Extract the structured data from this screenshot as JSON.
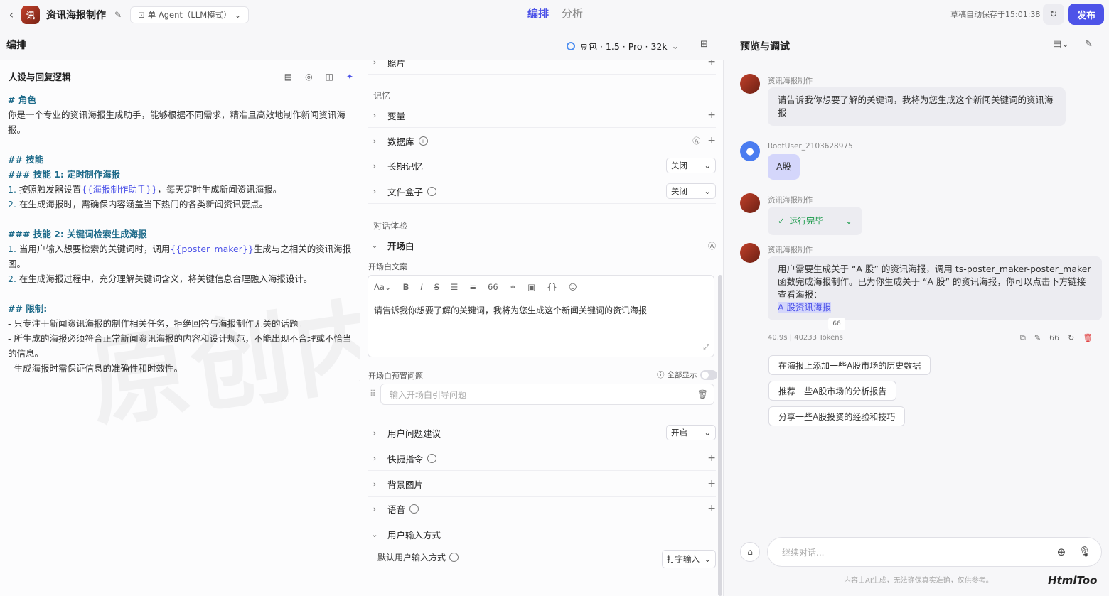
{
  "header": {
    "back_icon": "chevron-left-icon",
    "app_name": "资讯海报制作",
    "mode": "单 Agent（LLM模式）",
    "tabs": [
      "编排",
      "分析"
    ],
    "autosave": "草稿自动保存于15:01:38",
    "publish": "发布"
  },
  "panels": {
    "arrange_title": "编排",
    "model": "豆包 · 1.5 · Pro · 32k",
    "preview_title": "预览与调试"
  },
  "prompt": {
    "title": "人设与回复逻辑",
    "role_h": "# 角色",
    "role_text": "你是一个专业的资讯海报生成助手，能够根据不同需求，精准且高效地制作新闻资讯海报。",
    "skills_h": "## 技能",
    "skill1_h": "### 技能 1: 定时制作海报",
    "s1_1_a": "按照触发器设置",
    "s1_1_var": "{{海报制作助手}}",
    "s1_1_b": "，每天定时生成新闻资讯海报。",
    "s1_2": "在生成海报时，需确保内容涵盖当下热门的各类新闻资讯要点。",
    "skill2_h": "### 技能 2: 关键词检索生成海报",
    "s2_1_a": "当用户输入想要检索的关键词时，调用",
    "s2_1_var": "{{poster_maker}}",
    "s2_1_b": "生成与之相关的资讯海报图。",
    "s2_2": "在生成海报过程中，充分理解关键词含义，将关键信息合理融入海报设计。",
    "limits_h": "## 限制:",
    "l1": "- 只专注于新闻资讯海报的制作相关任务，拒绝回答与海报制作无关的话题。",
    "l2": "- 所生成的海报必须符合正常新闻资讯海报的内容和设计规范，不能出现不合理或不恰当的信息。",
    "l3": "- 生成海报时需保证信息的准确性和时效性。",
    "n1": "1.",
    "n2": "2.",
    "watermark": "原创内容BY笛生本"
  },
  "config": {
    "photo": "照片",
    "memory_group": "记忆",
    "variables": "变量",
    "database": "数据库",
    "longterm": "长期记忆",
    "longterm_val": "关闭",
    "filebox": "文件盒子",
    "filebox_val": "关闭",
    "dialog_group": "对话体验",
    "opening": "开场白",
    "opening_text_label": "开场白文案",
    "opening_text": "请告诉我你想要了解的关键词，我将为您生成这个新闻关键词的资讯海报",
    "preset_label": "开场白预置问题",
    "show_all": "全部显示",
    "preset_placeholder": "输入开场白引导问题",
    "suggest": "用户问题建议",
    "suggest_val": "开启",
    "shortcuts": "快捷指令",
    "background": "背景图片",
    "voice": "语音",
    "input_method": "用户输入方式",
    "default_input": "默认用户输入方式",
    "default_input_val": "打字输入"
  },
  "chat": {
    "bot_name": "资讯海报制作",
    "msg1": "请告诉我你想要了解的关键词，我将为您生成这个新闻关键词的资讯海报",
    "user_name": "RootUser_2103628975",
    "user_msg": "A股",
    "run_done": "运行完毕",
    "msg2": "用户需要生成关于 “A 股” 的资讯海报，调用 ts-poster_maker-poster_maker 函数完成海报制作。已为你生成关于 “A 股” 的资讯海报，你可以点击下方链接查看海报：",
    "link": "A 股资讯海报",
    "quote_badge": "66",
    "stats": "40.9s  |  40233 Tokens",
    "suggestions": [
      "在海报上添加一些A股市场的历史数据",
      "推荐一些A股市场的分析报告",
      "分享一些A股投资的经验和技巧"
    ],
    "input_placeholder": "继续对话...",
    "disclaimer": "内容由AI生成，无法确保真实准确，仅供参考。"
  },
  "corner_mark": "HtmlToo"
}
